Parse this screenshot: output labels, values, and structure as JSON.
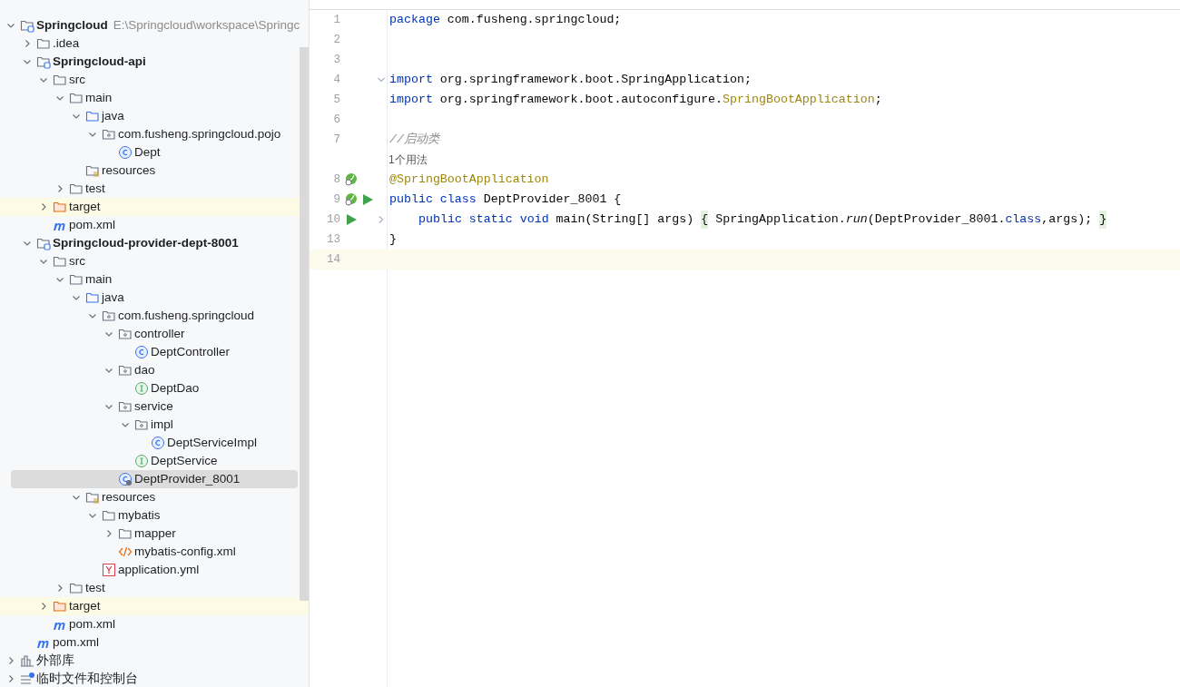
{
  "project_tree": [
    {
      "label": "Springcloud",
      "path": "E:\\Springcloud\\workspace\\Springc",
      "kind": "module",
      "bold": true,
      "expanded": true,
      "children": [
        {
          "label": ".idea",
          "kind": "folder",
          "expanded": false
        },
        {
          "label": "Springcloud-api",
          "kind": "module",
          "bold": true,
          "expanded": true,
          "children": [
            {
              "label": "src",
              "kind": "folder",
              "expanded": true,
              "children": [
                {
                  "label": "main",
                  "kind": "folder",
                  "expanded": true,
                  "children": [
                    {
                      "label": "java",
                      "kind": "source",
                      "expanded": true,
                      "children": [
                        {
                          "label": "com.fusheng.springcloud.pojo",
                          "kind": "package",
                          "expanded": true,
                          "children": [
                            {
                              "label": "Dept",
                              "kind": "class"
                            }
                          ]
                        }
                      ]
                    },
                    {
                      "label": "resources",
                      "kind": "resources"
                    }
                  ]
                },
                {
                  "label": "test",
                  "kind": "folder",
                  "expanded": false
                }
              ]
            },
            {
              "label": "target",
              "kind": "excluded",
              "excluded": true,
              "expanded": false
            },
            {
              "label": "pom.xml",
              "kind": "maven"
            }
          ]
        },
        {
          "label": "Springcloud-provider-dept-8001",
          "kind": "module",
          "bold": true,
          "expanded": true,
          "children": [
            {
              "label": "src",
              "kind": "folder",
              "expanded": true,
              "children": [
                {
                  "label": "main",
                  "kind": "folder",
                  "expanded": true,
                  "children": [
                    {
                      "label": "java",
                      "kind": "source",
                      "expanded": true,
                      "children": [
                        {
                          "label": "com.fusheng.springcloud",
                          "kind": "package",
                          "expanded": true,
                          "children": [
                            {
                              "label": "controller",
                              "kind": "package",
                              "expanded": true,
                              "children": [
                                {
                                  "label": "DeptController",
                                  "kind": "class"
                                }
                              ]
                            },
                            {
                              "label": "dao",
                              "kind": "package",
                              "expanded": true,
                              "children": [
                                {
                                  "label": "DeptDao",
                                  "kind": "interface"
                                }
                              ]
                            },
                            {
                              "label": "service",
                              "kind": "package",
                              "expanded": true,
                              "children": [
                                {
                                  "label": "impl",
                                  "kind": "package",
                                  "expanded": true,
                                  "children": [
                                    {
                                      "label": "DeptServiceImpl",
                                      "kind": "class"
                                    }
                                  ]
                                },
                                {
                                  "label": "DeptService",
                                  "kind": "interface"
                                }
                              ]
                            },
                            {
                              "label": "DeptProvider_8001",
                              "kind": "spring_class",
                              "selected": true
                            }
                          ]
                        }
                      ]
                    },
                    {
                      "label": "resources",
                      "kind": "resources",
                      "expanded": true,
                      "children": [
                        {
                          "label": "mybatis",
                          "kind": "folder",
                          "expanded": true,
                          "children": [
                            {
                              "label": "mapper",
                              "kind": "folder",
                              "expanded": false
                            },
                            {
                              "label": "mybatis-config.xml",
                              "kind": "xml"
                            }
                          ]
                        },
                        {
                          "label": "application.yml",
                          "kind": "yaml"
                        }
                      ]
                    }
                  ]
                },
                {
                  "label": "test",
                  "kind": "folder",
                  "expanded": false
                }
              ]
            },
            {
              "label": "target",
              "kind": "excluded",
              "excluded": true,
              "expanded": false
            },
            {
              "label": "pom.xml",
              "kind": "maven"
            }
          ]
        },
        {
          "label": "pom.xml",
          "kind": "maven"
        }
      ]
    },
    {
      "label": "外部库",
      "kind": "library",
      "expanded": false
    },
    {
      "label": "临时文件和控制台",
      "kind": "scratch",
      "expanded": false
    }
  ],
  "editor": {
    "lines": [
      {
        "number": "1",
        "tokens": [
          {
            "kind": "keyword",
            "text": "package"
          },
          {
            "kind": "plain",
            "text": " com.fusheng.springcloud;"
          }
        ]
      },
      {
        "number": "2"
      },
      {
        "number": "3"
      },
      {
        "number": "4",
        "folded": false,
        "tokens": [
          {
            "kind": "keyword",
            "text": "import"
          },
          {
            "kind": "plain",
            "text": " org.springframework.boot.SpringApplication;"
          }
        ]
      },
      {
        "number": "5",
        "tokens": [
          {
            "kind": "keyword",
            "text": "import"
          },
          {
            "kind": "plain",
            "text": " org.springframework.boot.autoconfigure."
          },
          {
            "kind": "annotation",
            "text": "SpringBootApplication"
          },
          {
            "kind": "plain",
            "text": ";"
          }
        ]
      },
      {
        "number": "6"
      },
      {
        "number": "7",
        "tokens": [
          {
            "kind": "comment",
            "text": "//启动类"
          }
        ]
      },
      {
        "kind": "hint",
        "text": "1个用法"
      },
      {
        "number": "8",
        "gutter": [
          {
            "kind": "bean"
          }
        ],
        "tokens": [
          {
            "kind": "annotation",
            "text": "@SpringBootApplication"
          }
        ]
      },
      {
        "number": "9",
        "gutter": [
          {
            "kind": "bean"
          },
          {
            "kind": "run"
          }
        ],
        "tokens": [
          {
            "kind": "keyword",
            "text": "public class"
          },
          {
            "kind": "plain",
            "text": " DeptProvider_8001 {"
          }
        ]
      },
      {
        "number": "10",
        "gutter": [
          {
            "kind": "run"
          }
        ],
        "folded": true,
        "indent": true,
        "tokens": [
          {
            "kind": "keyword",
            "text": "public static void"
          },
          {
            "kind": "plain",
            "text": " main(String[] args) "
          },
          {
            "kind": "folded",
            "text": "{"
          },
          {
            "kind": "plain",
            "text": " SpringApplication."
          },
          {
            "kind": "static",
            "text": "run"
          },
          {
            "kind": "plain",
            "text": "(DeptProvider_8001."
          },
          {
            "kind": "keyword",
            "text": "class"
          },
          {
            "kind": "plain",
            "text": ",args); "
          },
          {
            "kind": "folded",
            "text": "}"
          }
        ]
      },
      {
        "number": "13",
        "tokens": [
          {
            "kind": "plain",
            "text": "}"
          }
        ]
      },
      {
        "number": "14",
        "current": true
      }
    ]
  }
}
